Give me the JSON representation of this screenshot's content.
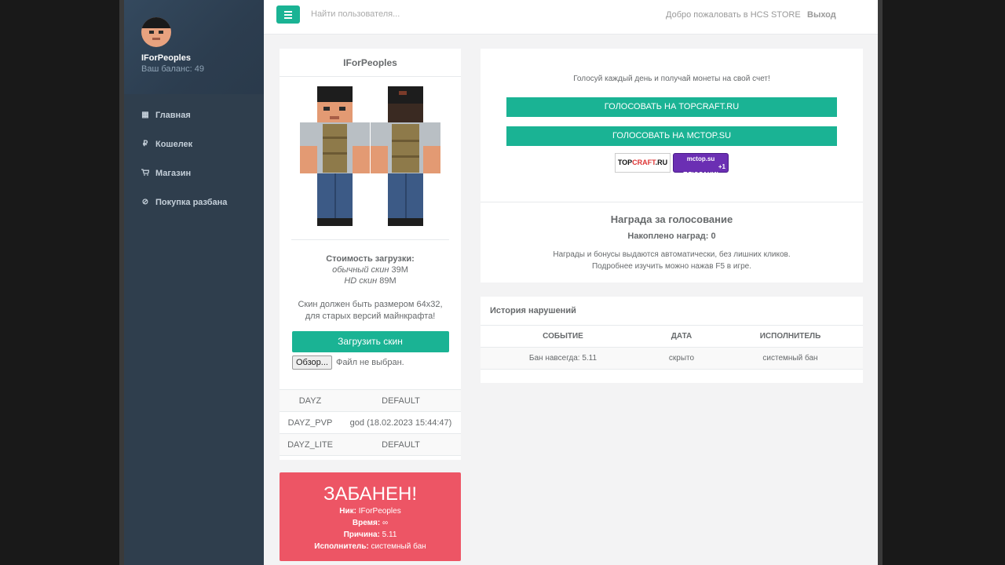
{
  "user": {
    "name": "IForPeoples",
    "balance": "Ваш баланс: 49"
  },
  "sidebar": {
    "items": [
      {
        "label": "Главная",
        "icon": "grid-icon"
      },
      {
        "label": "Кошелек",
        "icon": "ruble-icon"
      },
      {
        "label": "Магазин",
        "icon": "cart-icon"
      },
      {
        "label": "Покупка разбана",
        "icon": "ban-icon"
      }
    ]
  },
  "topbar": {
    "search_placeholder": "Найти пользователя...",
    "welcome": "Добро пожаловать в HCS STORE",
    "logout": "Выход"
  },
  "skin_panel": {
    "title": "IForPeoples",
    "cost_title": "Стоимость загрузки:",
    "cost_normal_label": "обычный скин",
    "cost_normal_value": " 39M",
    "cost_hd_label": "HD скин",
    "cost_hd_value": " 89M",
    "note_line1": "Скин должен быть размером 64x32,",
    "note_line2": "для старых версий майнкрафта!",
    "upload_button": "Загрузить скин",
    "browse_button": "Обзор...",
    "no_file": "Файл не выбран."
  },
  "servers": [
    {
      "name": "DAYZ",
      "status": "DEFAULT"
    },
    {
      "name": "DAYZ_PVP",
      "status": "god (18.02.2023 15:44:47)"
    },
    {
      "name": "DAYZ_LITE",
      "status": "DEFAULT"
    }
  ],
  "ban": {
    "title": "ЗАБАНЕН!",
    "nick_label": "Ник:",
    "nick_value": " IForPeoples",
    "time_label": "Время:",
    "time_value": " ∞",
    "reason_label": "Причина:",
    "reason_value": " 5.11",
    "executor_label": "Исполнитель:",
    "executor_value": " системный бан"
  },
  "vote": {
    "text": "Голосуй каждый день и получай монеты на свой счет!",
    "button1": "ГОЛОСОВАТЬ НА TOPCRAFT.RU",
    "button2": "ГОЛОСОВАТЬ НА MCTOP.SU",
    "badge_top_a": "TOP",
    "badge_top_b": "CRAFT",
    "badge_top_c": ".RU",
    "badge_mc_line1": "mctop.su",
    "badge_mc_line2": "+1",
    "badge_mc_line3": "ПЛЮСАНИ!",
    "reward_title": "Награда за голосование",
    "reward_count": "Накоплено наград: 0",
    "reward_note1": "Награды и бонусы выдаются автоматически, без лишних кликов.",
    "reward_note2": "Подробнее изучить можно нажав F5 в игре."
  },
  "history": {
    "title": "История нарушений",
    "columns": [
      "СОБЫТИЕ",
      "ДАТА",
      "ИСПОЛНИТЕЛЬ"
    ],
    "rows": [
      {
        "event": "Бан навсегда: 5.11",
        "date": "скрыто",
        "executor": "системный бан"
      }
    ]
  },
  "colors": {
    "accent": "#1ab394",
    "danger": "#ed5565",
    "sidebar": "#2f3e4d"
  }
}
